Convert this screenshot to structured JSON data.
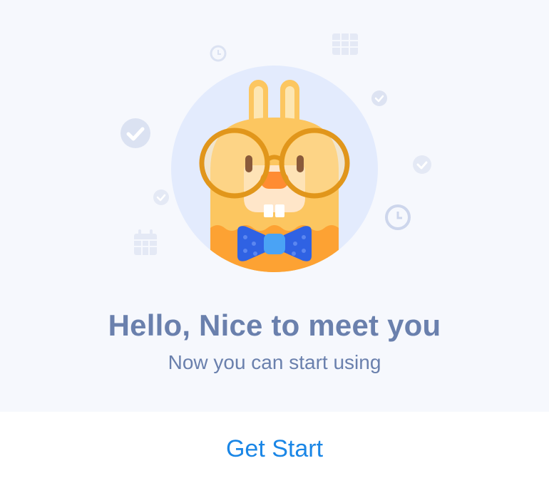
{
  "welcome": {
    "title": "Hello, Nice to meet you",
    "subtitle": "Now you can start using"
  },
  "action": {
    "get_start_label": "Get Start"
  },
  "illustration": {
    "character": "rabbit-with-glasses-and-bowtie",
    "decor_icons": [
      "check-circle-icon",
      "clock-icon",
      "calendar-icon",
      "grid-calendar-icon"
    ]
  },
  "colors": {
    "background": "#f6f8fd",
    "text": "#6a80ad",
    "accent": "#1a86e6",
    "circle": "#e3ebfd",
    "rabbit_body": "#fcc660",
    "rabbit_lower": "#fda233",
    "glasses": "#e1961b",
    "bowtie": "#2f62e3"
  }
}
